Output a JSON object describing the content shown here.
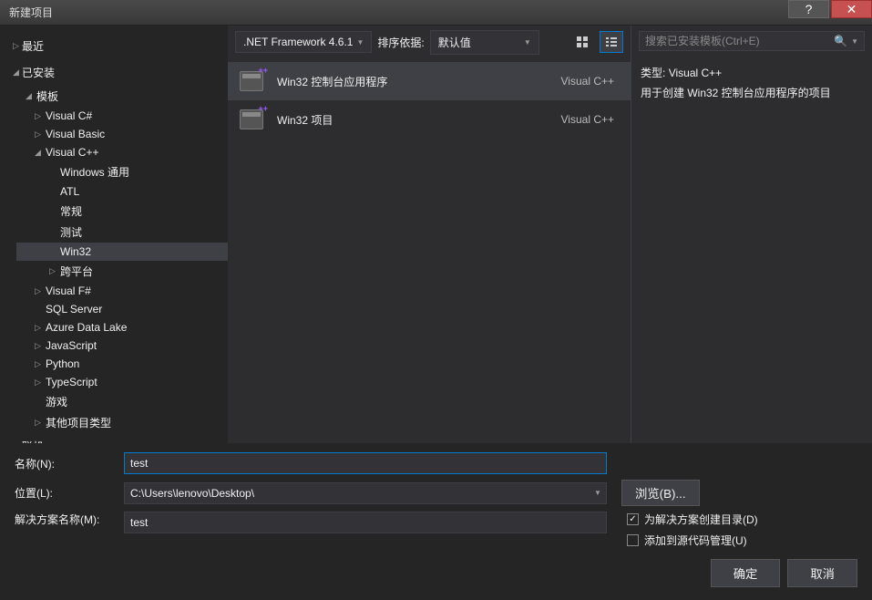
{
  "window": {
    "title": "新建项目"
  },
  "sidebar": {
    "recent": "最近",
    "installed": "已安装",
    "templates_root": "模板",
    "nodes": [
      {
        "label": "Visual C#",
        "expandable": true
      },
      {
        "label": "Visual Basic",
        "expandable": true
      },
      {
        "label": "Visual C++",
        "expandable": true,
        "expanded": true,
        "children": [
          {
            "label": "Windows 通用"
          },
          {
            "label": "ATL"
          },
          {
            "label": "常规"
          },
          {
            "label": "测试"
          },
          {
            "label": "Win32",
            "selected": true
          },
          {
            "label": "跨平台",
            "expandable": true
          }
        ]
      },
      {
        "label": "Visual F#",
        "expandable": true
      },
      {
        "label": "SQL Server"
      },
      {
        "label": "Azure Data Lake",
        "expandable": true
      },
      {
        "label": "JavaScript",
        "expandable": true
      },
      {
        "label": "Python",
        "expandable": true
      },
      {
        "label": "TypeScript",
        "expandable": true
      },
      {
        "label": "游戏"
      },
      {
        "label": "其他项目类型",
        "expandable": true
      }
    ],
    "online": "联机"
  },
  "toolbar": {
    "framework": ".NET Framework 4.6.1",
    "sort_label": "排序依据:",
    "sort_value": "默认值"
  },
  "templates": [
    {
      "name": "Win32 控制台应用程序",
      "lang": "Visual C++",
      "selected": true
    },
    {
      "name": "Win32 项目",
      "lang": "Visual C++"
    }
  ],
  "search": {
    "placeholder": "搜索已安装模板(Ctrl+E)"
  },
  "info": {
    "type_label": "类型:",
    "type_value": "Visual C++",
    "description": "用于创建 Win32 控制台应用程序的项目"
  },
  "form": {
    "name_label": "名称(N):",
    "name_value": "test",
    "location_label": "位置(L):",
    "location_value": "C:\\Users\\lenovo\\Desktop\\",
    "solution_label": "解决方案名称(M):",
    "solution_value": "test",
    "browse": "浏览(B)...",
    "create_dir": "为解决方案创建目录(D)",
    "add_source": "添加到源代码管理(U)"
  },
  "buttons": {
    "ok": "确定",
    "cancel": "取消"
  }
}
